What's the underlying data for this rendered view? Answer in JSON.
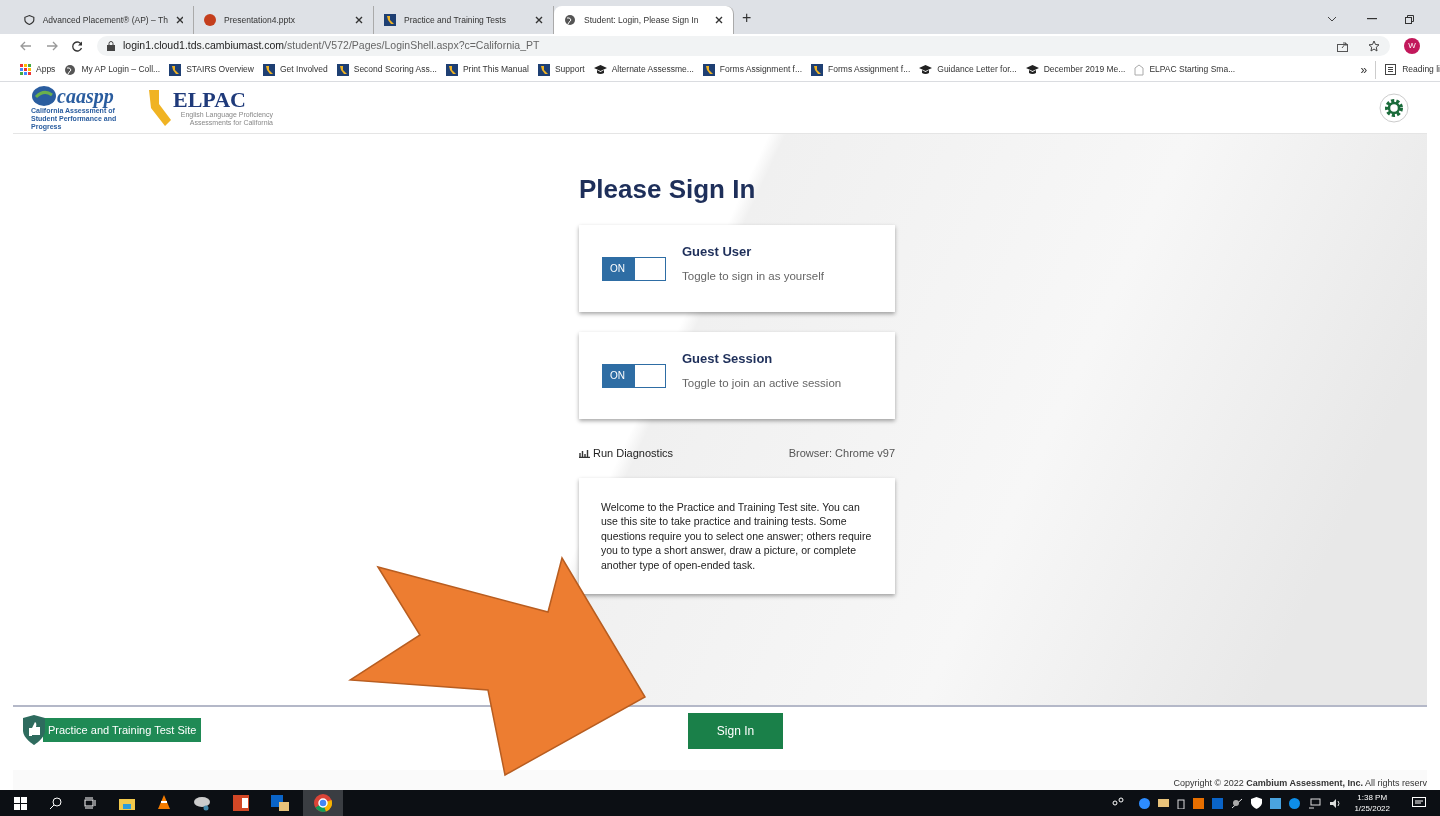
{
  "browser": {
    "tabs": [
      {
        "title": "Advanced Placement® (AP) – Th",
        "selected": false
      },
      {
        "title": "Presentation4.pptx",
        "selected": false
      },
      {
        "title": "Practice and Training Tests",
        "selected": false
      },
      {
        "title": "Student: Login, Please Sign In",
        "selected": true
      }
    ],
    "new_tab": "+",
    "url_host": "login1.cloud1.tds.cambiumast.com",
    "url_path": "/student/V572/Pages/LoginShell.aspx?c=California_PT",
    "profile": "W",
    "bookmarks": [
      "Apps",
      "My AP Login – Coll...",
      "STAIRS Overview",
      "Get Involved",
      "Second Scoring Ass...",
      "Print This Manual",
      "Support",
      "Alternate Assessme...",
      "Forms Assignment f...",
      "Forms Assignment f...",
      "Guidance Letter for...",
      "December 2019 Me...",
      "ELPAC Starting Sma..."
    ],
    "more": "»",
    "reading_list": "Reading li"
  },
  "header": {
    "caaspp_logo": "caaspp",
    "caaspp_caption": "California Assessment of Student Performance and Progress",
    "elpac_logo": "ELPAC",
    "elpac_caption": "English Language Proficiency Assessments for California"
  },
  "login": {
    "title": "Please Sign In",
    "toggles": [
      {
        "switch_label": "ON",
        "on": true,
        "title": "Guest User",
        "subtitle": "Toggle to sign in as yourself"
      },
      {
        "switch_label": "ON",
        "on": true,
        "title": "Guest Session",
        "subtitle": "Toggle to join an active session"
      }
    ],
    "diagnostics": "Run Diagnostics",
    "browser_info": "Browser: Chrome v97",
    "welcome": "Welcome to the Practice and Training Test site. You can use this site to take practice and training tests. Some questions require you to select one answer; others require you to type a short answer, draw a picture, or complete another type of open-ended task."
  },
  "footer": {
    "site_badge": "Practice and Training Test Site",
    "sign_in": "Sign In",
    "copyright": "Copyright © 2022 **Cambium Assessment, Inc.** All rights reserv"
  },
  "taskbar": {
    "time": "1:38 PM",
    "date": "1/25/2022"
  }
}
